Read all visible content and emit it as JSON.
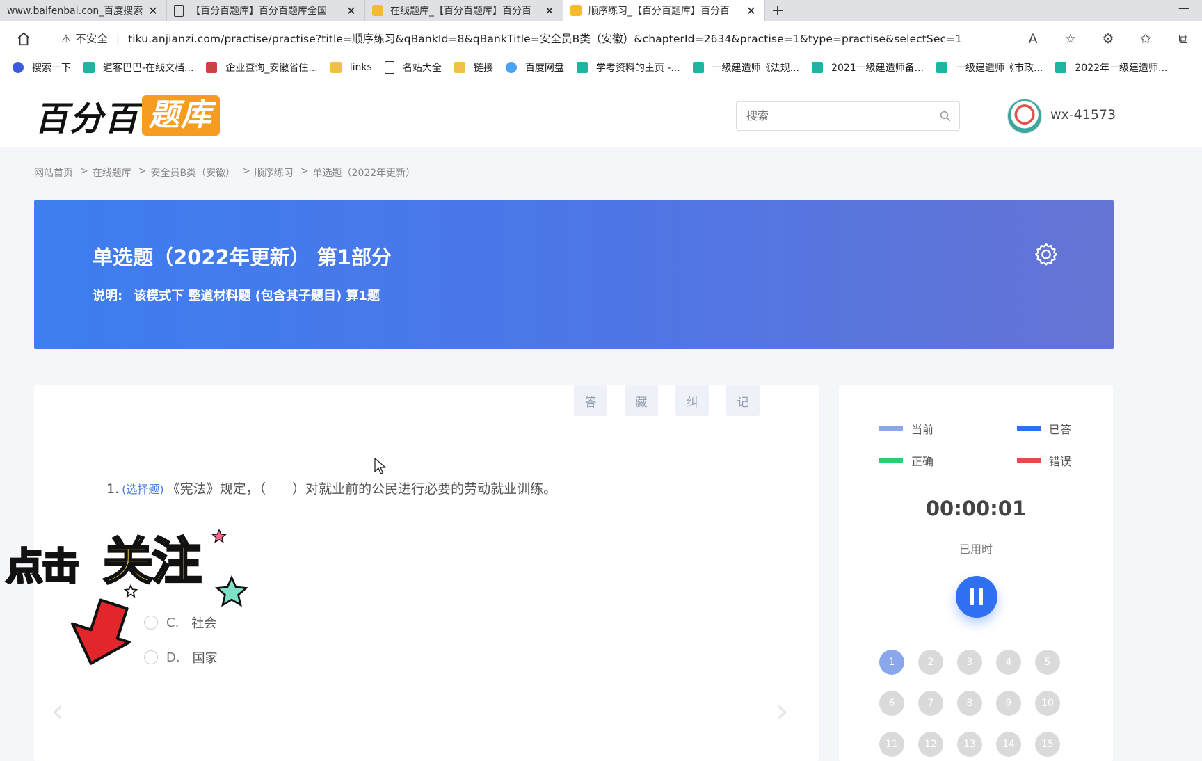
{
  "browser": {
    "tabs": [
      {
        "title": "www.baifenbai.con_百度搜索"
      },
      {
        "title": "【百分百题库】百分百题库全国"
      },
      {
        "title": "在线题库_【百分百题库】百分百"
      },
      {
        "title": "顺序练习_【百分百题库】百分百"
      }
    ],
    "new_tab": "+",
    "minimize": "—",
    "security_label": "不安全",
    "url": "tiku.anjianzi.com/practise/practise?title=顺序练习&qBankId=8&qBankTitle=安全员B类（安徽）&chapterId=2634&practise=1&type=practise&selectSec=1",
    "bookmarks": [
      {
        "label": "搜索一下"
      },
      {
        "label": "道客巴巴-在线文档..."
      },
      {
        "label": "企业查询_安徽省住..."
      },
      {
        "label": "links"
      },
      {
        "label": "名站大全"
      },
      {
        "label": "链接"
      },
      {
        "label": "百度网盘"
      },
      {
        "label": "学考资料的主页 -..."
      },
      {
        "label": "一级建造师《法规..."
      },
      {
        "label": "2021一级建造师备..."
      },
      {
        "label": "一级建造师《市政..."
      },
      {
        "label": "2022年一级建造师..."
      }
    ]
  },
  "site": {
    "logo_part1": "百分百",
    "logo_part2": "题库",
    "search_placeholder": "搜索",
    "username": "wx-41573"
  },
  "breadcrumb": [
    "网站首页",
    "在线题库",
    "安全员B类（安徽）",
    "顺序练习",
    "单选题（2022年更新）"
  ],
  "banner": {
    "title": "单选题（2022年更新） 第1部分",
    "desc_label": "说明:",
    "desc": "该模式下 整道材料题 (包含其子题目) 算1题"
  },
  "tools": [
    "答",
    "藏",
    "纠",
    "记"
  ],
  "question": {
    "number": "1.",
    "type": "(选择题)",
    "text": "《宪法》规定，（　　）对就业前的公民进行必要的劳动就业训练。",
    "options": [
      {
        "label": "C.",
        "text": "社会"
      },
      {
        "label": "D.",
        "text": "国家"
      }
    ]
  },
  "sticker": {
    "t1": "点击",
    "t2": "关注"
  },
  "panel": {
    "legend": [
      {
        "label": "当前",
        "color": "#8aa8ea"
      },
      {
        "label": "已答",
        "color": "#2f6ff0"
      },
      {
        "label": "正确",
        "color": "#2ecc71"
      },
      {
        "label": "错误",
        "color": "#e54b4b"
      }
    ],
    "timer": "00:00:01",
    "timer_label": "已用时",
    "numbers": [
      "1",
      "2",
      "3",
      "4",
      "5",
      "6",
      "7",
      "8",
      "9",
      "10",
      "11",
      "12",
      "13",
      "14",
      "15"
    ]
  }
}
